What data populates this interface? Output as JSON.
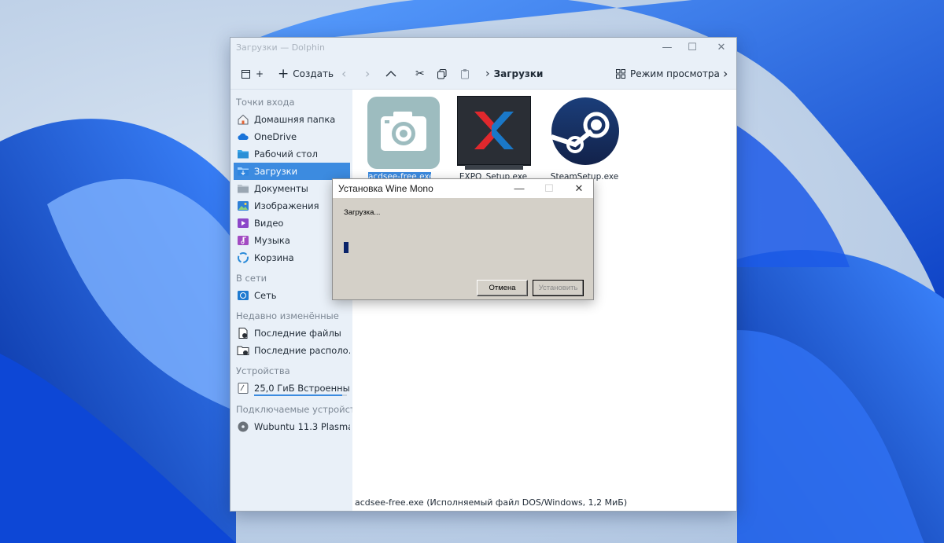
{
  "window": {
    "title": "Загрузки — Dolphin"
  },
  "toolbar": {
    "new_tab_label": "+",
    "create_label": "Создать",
    "breadcrumb": "Загрузки",
    "view_mode_label": "Режим просмотра"
  },
  "sidebar": {
    "sections": [
      {
        "title": "Точки входа",
        "items": [
          {
            "label": "Домашняя папка",
            "icon": "home-icon"
          },
          {
            "label": "OneDrive",
            "icon": "cloud-icon"
          },
          {
            "label": "Рабочий стол",
            "icon": "desktop-folder-icon"
          },
          {
            "label": "Загрузки",
            "icon": "downloads-folder-icon",
            "selected": true
          },
          {
            "label": "Документы",
            "icon": "documents-folder-icon"
          },
          {
            "label": "Изображения",
            "icon": "pictures-icon"
          },
          {
            "label": "Видео",
            "icon": "video-icon"
          },
          {
            "label": "Музыка",
            "icon": "music-icon"
          },
          {
            "label": "Корзина",
            "icon": "trash-icon"
          }
        ]
      },
      {
        "title": "В сети",
        "items": [
          {
            "label": "Сеть",
            "icon": "network-icon"
          }
        ]
      },
      {
        "title": "Недавно изменённые",
        "items": [
          {
            "label": "Последние файлы",
            "icon": "recent-files-icon"
          },
          {
            "label": "Последние располо...",
            "icon": "recent-locations-icon"
          }
        ]
      },
      {
        "title": "Устройства",
        "items": [
          {
            "label": "25,0 ГиБ Встроенны...",
            "icon": "drive-icon",
            "usage": 0.95
          }
        ]
      },
      {
        "title": "Подключаемые устройст...",
        "items": [
          {
            "label": "Wubuntu 11.3 Plasma",
            "icon": "optical-disc-icon"
          }
        ]
      }
    ]
  },
  "files": [
    {
      "name": "acdsee-free.exe",
      "icon": "acdsee-camera-icon",
      "selected": true
    },
    {
      "name": "EXPO_Setup.exe",
      "icon": "expo-x-icon"
    },
    {
      "name": "SteamSetup.exe",
      "icon": "steam-icon"
    }
  ],
  "statusbar": {
    "text": "acdsee-free.exe (Исполняемый файл DOS/Windows, 1,2 МиБ)"
  },
  "wine_dialog": {
    "title": "Установка Wine Mono",
    "message": "Загрузка...",
    "progress": 0.03,
    "cancel_label": "Отмена",
    "install_label": "Установить"
  },
  "colors": {
    "selection": "#3c8be0",
    "progress": "#0a246a",
    "wine_face": "#d4d0c8"
  }
}
